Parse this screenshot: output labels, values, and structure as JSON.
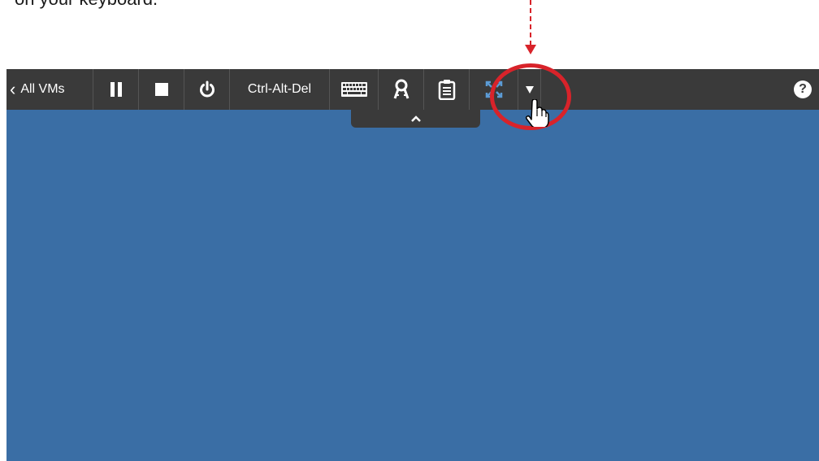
{
  "caption": "on your keyboard.",
  "toolbar": {
    "back_label": "All VMs",
    "ctrl_alt_del_label": "Ctrl-Alt-Del",
    "help_label": "?"
  },
  "icons": [
    "chevron-left-icon",
    "pause-icon",
    "stop-icon",
    "power-icon",
    "keyboard-icon",
    "keys-icon",
    "clipboard-icon",
    "fullscreen-icon",
    "dropdown-arrow-icon",
    "help-icon",
    "chevron-up-icon",
    "hand-cursor-icon"
  ],
  "colors": {
    "toolbar_bg": "#3a3a3a",
    "console_bg": "#3a6ea5",
    "highlight": "#d8232a",
    "fullscreen_icon": "#5b9bd5"
  }
}
